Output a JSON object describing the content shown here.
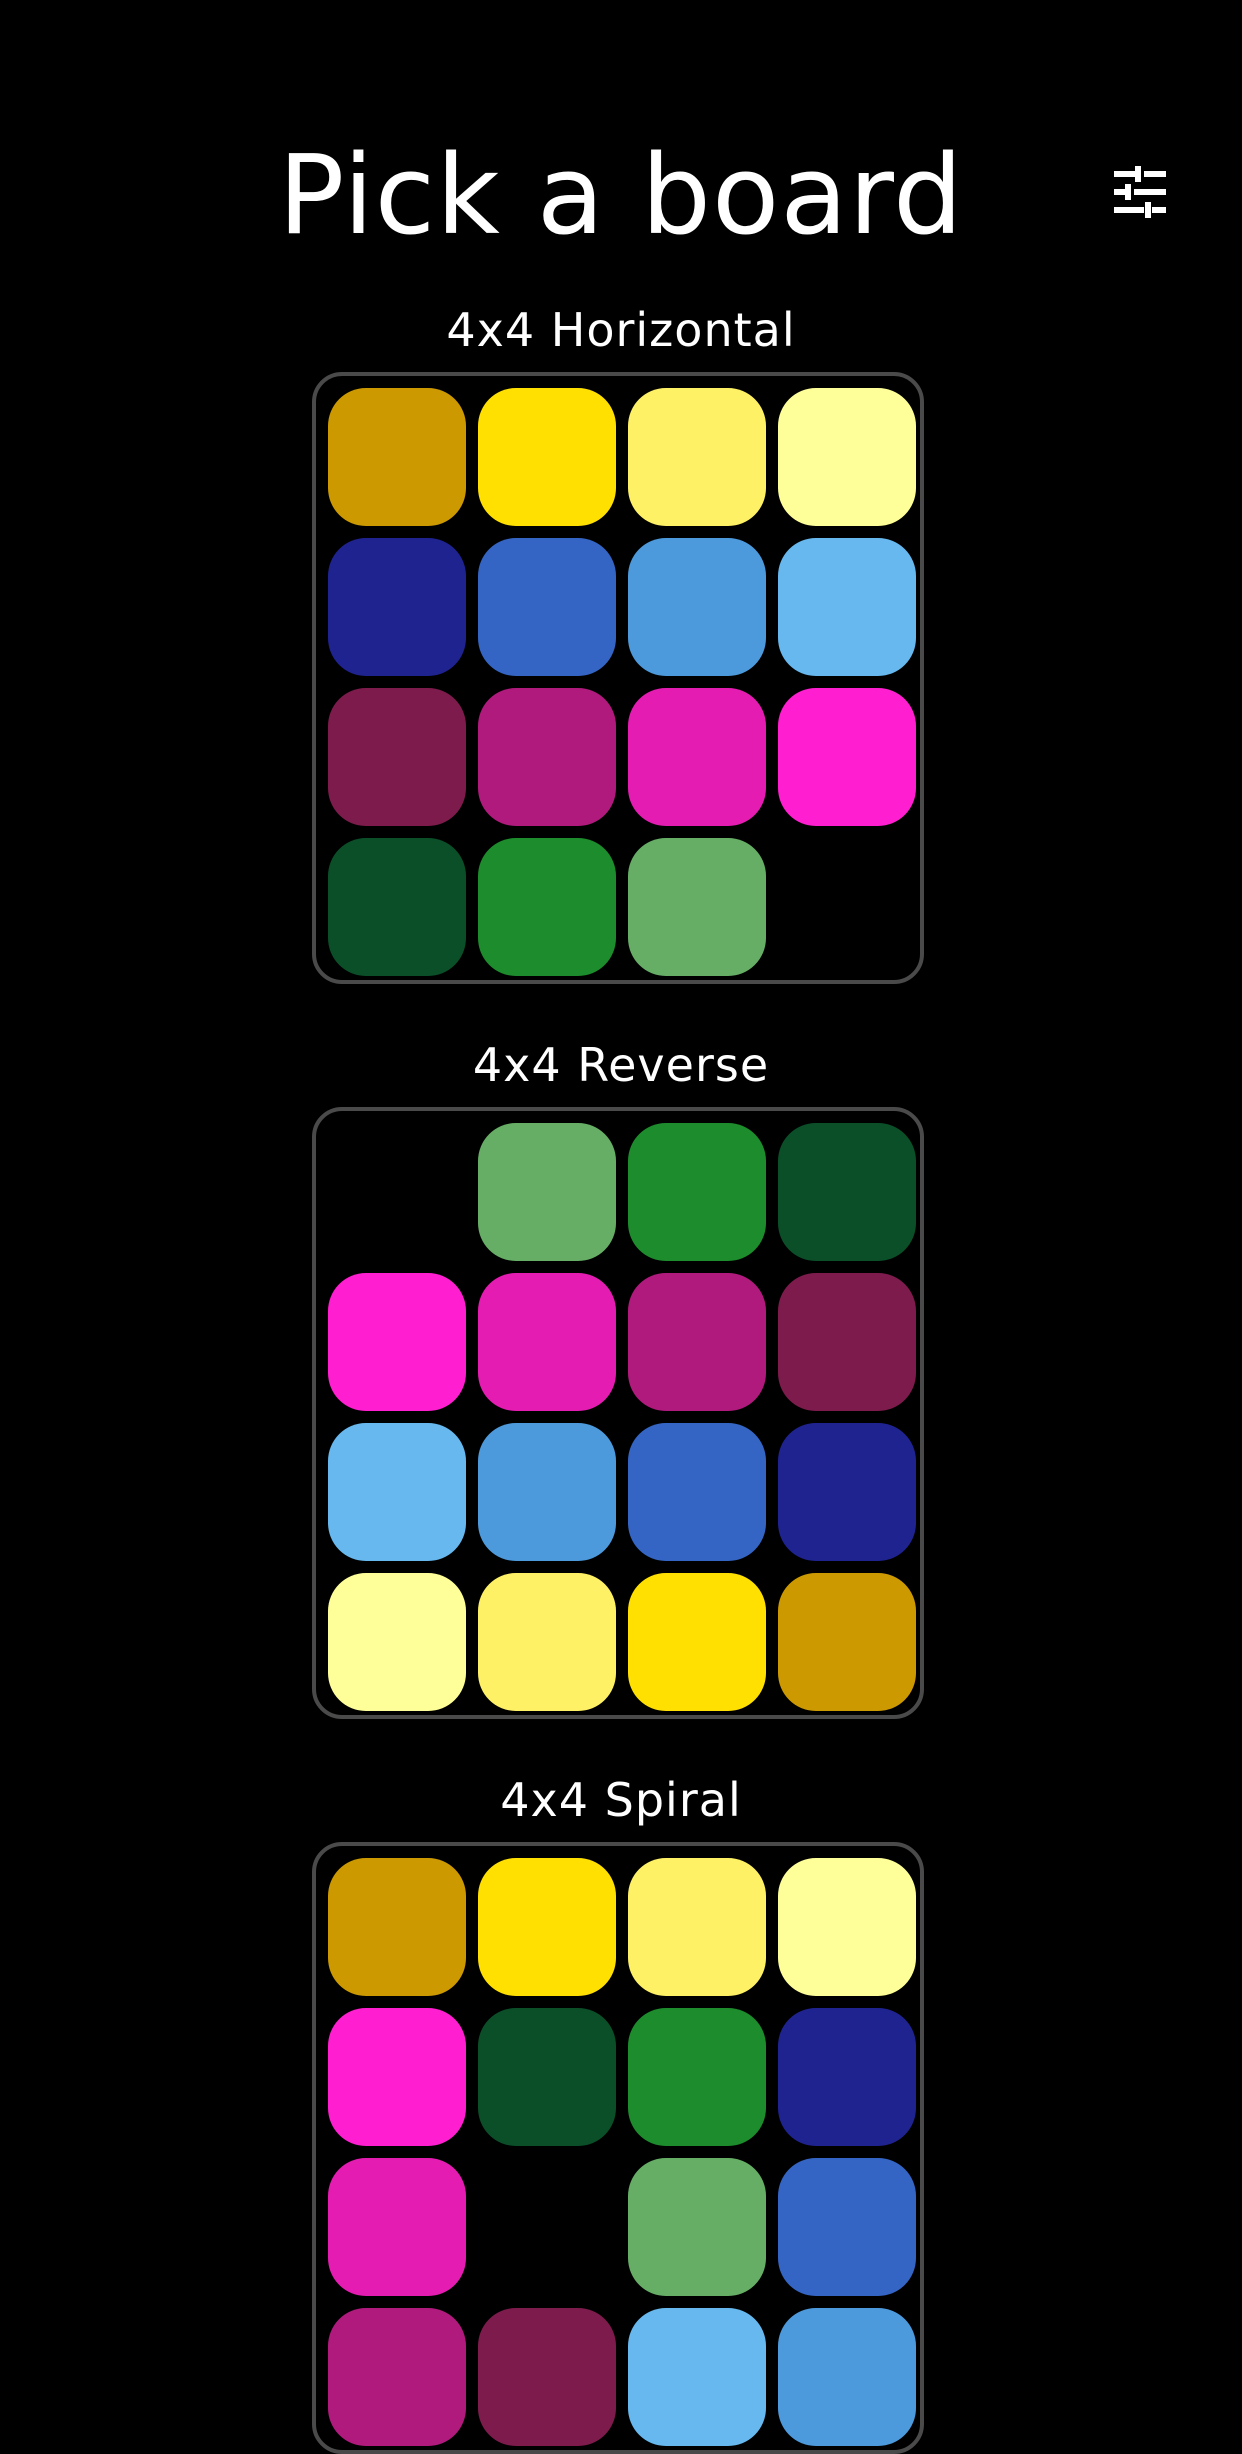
{
  "header": {
    "title": "Pick a board",
    "settings_icon": "sliders-icon"
  },
  "boards": [
    {
      "label": "4x4 Horizontal",
      "tiles": [
        [
          "#CC9900",
          "#FFE000",
          "#FFF166",
          "#FFFF99"
        ],
        [
          "#1F2390",
          "#3465C4",
          "#4C99DC",
          "#66B8EE"
        ],
        [
          "#7D1B4C",
          "#B01A7D",
          "#E41CB2",
          "#FF1ED0"
        ],
        [
          "#0B4F29",
          "#1C8C2C",
          "#66AE66",
          null
        ]
      ]
    },
    {
      "label": "4x4 Reverse",
      "tiles": [
        [
          null,
          "#66AE66",
          "#1C8C2C",
          "#0B4F29"
        ],
        [
          "#FF1ED0",
          "#E41CB2",
          "#B01A7D",
          "#7D1B4C"
        ],
        [
          "#66B8EE",
          "#4C99DC",
          "#3465C4",
          "#1F2390"
        ],
        [
          "#FFFF99",
          "#FFF166",
          "#FFE000",
          "#CC9900"
        ]
      ]
    },
    {
      "label": "4x4 Spiral",
      "tiles": [
        [
          "#CC9900",
          "#FFE000",
          "#FFF166",
          "#FFFF99"
        ],
        [
          "#FF1ED0",
          "#0B4F29",
          "#1C8C2C",
          "#1F2390"
        ],
        [
          "#E41CB2",
          null,
          "#66AE66",
          "#3465C4"
        ],
        [
          "#B01A7D",
          "#7D1B4C",
          "#66B8EE",
          "#4C99DC"
        ]
      ]
    }
  ]
}
